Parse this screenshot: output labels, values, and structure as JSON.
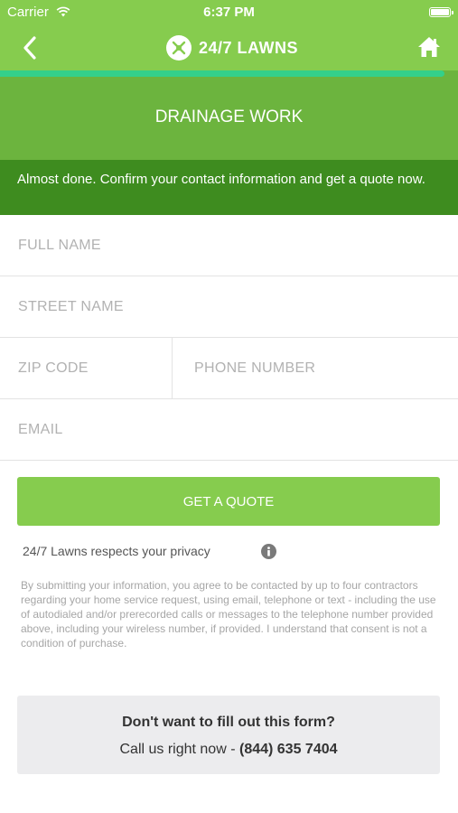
{
  "status_bar": {
    "carrier": "Carrier",
    "time": "6:37 PM"
  },
  "nav": {
    "brand": "24/7 LAWNS",
    "back_icon": "chevron-left-icon",
    "home_icon": "home-icon"
  },
  "progress": {
    "fraction": 0.97
  },
  "header": {
    "title": "DRAINAGE WORK"
  },
  "message": "Almost done. Confirm your contact information and get a quote now.",
  "form": {
    "full_name": {
      "placeholder": "FULL NAME",
      "value": ""
    },
    "street_name": {
      "placeholder": "STREET NAME",
      "value": ""
    },
    "zip_code": {
      "placeholder": "ZIP CODE",
      "value": ""
    },
    "phone_number": {
      "placeholder": "PHONE NUMBER",
      "value": ""
    },
    "email": {
      "placeholder": "EMAIL",
      "value": ""
    },
    "submit_label": "GET A QUOTE"
  },
  "privacy": {
    "text": "24/7 Lawns respects your privacy",
    "icon": "info-icon"
  },
  "disclaimer": "By submitting your information, you agree to be contacted by up to four contractors regarding your home service request, using email, telephone or text - including the use of autodialed and/or prerecorded calls or messages to the telephone number provided above, including your wireless number, if provided. I understand that consent is not a condition of purchase.",
  "call_box": {
    "question": "Don't want to fill out this form?",
    "prefix": "Call us right now - ",
    "phone": "(844) 635 7404"
  },
  "colors": {
    "brand_green": "#86cc4e",
    "mid_green": "#6cb43e",
    "dark_green": "#3e8c1f",
    "progress": "#34d08a"
  }
}
